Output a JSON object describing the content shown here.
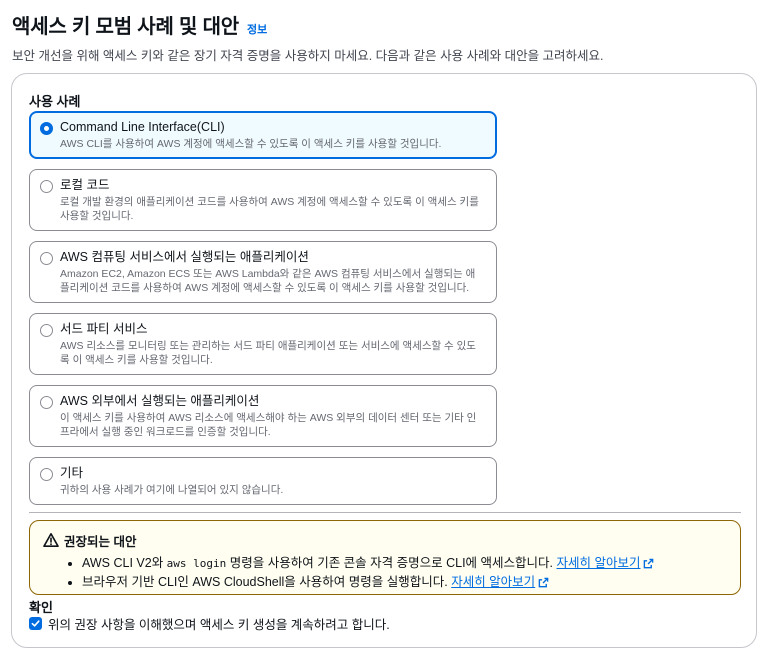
{
  "header": {
    "title": "액세스 키 모범 사례 및 대안",
    "info_link": "정보",
    "description": "보안 개선을 위해 액세스 키와 같은 장기 자격 증명을 사용하지 마세요. 다음과 같은 사용 사례와 대안을 고려하세요."
  },
  "use_cases": {
    "label": "사용 사례",
    "selected_index": 0,
    "options": [
      {
        "label": "Command Line Interface(CLI)",
        "description": "AWS CLI를 사용하여 AWS 계정에 액세스할 수 있도록 이 액세스 키를 사용할 것입니다."
      },
      {
        "label": "로컬 코드",
        "description": "로컬 개발 환경의 애플리케이션 코드를 사용하여 AWS 계정에 액세스할 수 있도록 이 액세스 키를 사용할 것입니다."
      },
      {
        "label": "AWS 컴퓨팅 서비스에서 실행되는 애플리케이션",
        "description": "Amazon EC2, Amazon ECS 또는 AWS Lambda와 같은 AWS 컴퓨팅 서비스에서 실행되는 애플리케이션 코드를 사용하여 AWS 계정에 액세스할 수 있도록 이 액세스 키를 사용할 것입니다."
      },
      {
        "label": "서드 파티 서비스",
        "description": "AWS 리소스를 모니터링 또는 관리하는 서드 파티 애플리케이션 또는 서비스에 액세스할 수 있도록 이 액세스 키를 사용할 것입니다."
      },
      {
        "label": "AWS 외부에서 실행되는 애플리케이션",
        "description": "이 액세스 키를 사용하여 AWS 리소스에 액세스해야 하는 AWS 외부의 데이터 센터 또는 기타 인프라에서 실행 중인 워크로드를 인증할 것입니다."
      },
      {
        "label": "기타",
        "description": "귀하의 사용 사례가 여기에 나열되어 있지 않습니다."
      }
    ]
  },
  "alert": {
    "title": "권장되는 대안",
    "item1_prefix": "AWS CLI V2와 ",
    "item1_code": "aws login",
    "item1_suffix": " 명령을 사용하여 기존 콘솔 자격 증명으로 CLI에 액세스합니다.",
    "item2_text": "브라우저 기반 CLI인 AWS CloudShell을 사용하여 명령을 실행합니다.",
    "learn_more": "자세히 알아보기",
    "warning_color": "#8d6605"
  },
  "confirmation": {
    "label": "확인",
    "checkbox_text": "위의 권장 사항을 이해했으며 액세스 키 생성을 계속하려고 합니다.",
    "checked": true
  },
  "colors": {
    "accent": "#006ce0",
    "selected_bg": "#f0fbff"
  }
}
